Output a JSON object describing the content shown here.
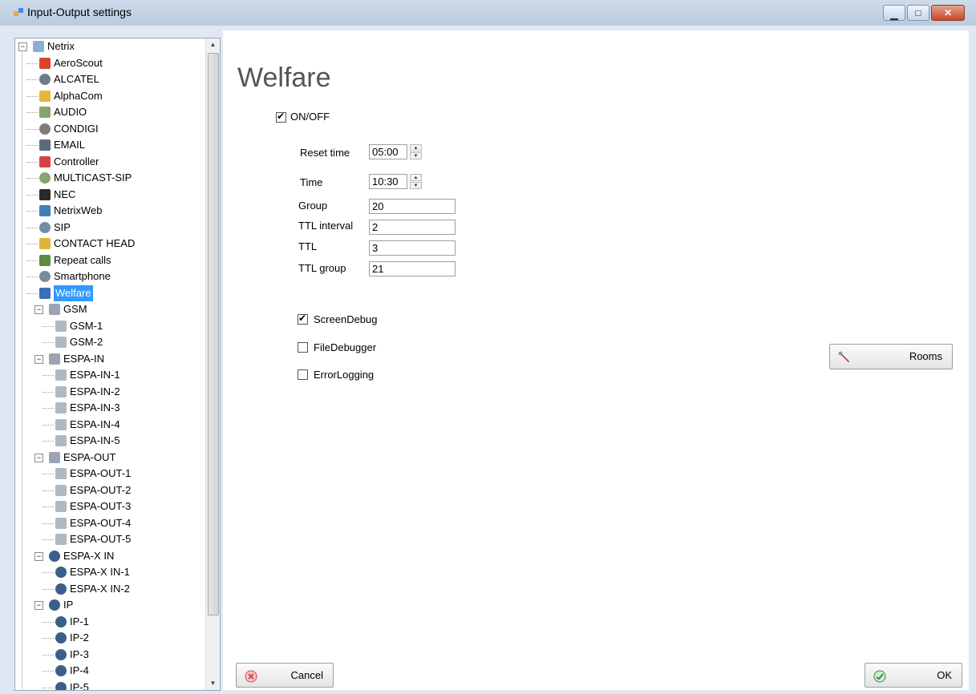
{
  "window": {
    "title": "Input-Output settings"
  },
  "tree": {
    "root": "Netrix",
    "items": [
      "AeroScout",
      "ALCATEL",
      "AlphaCom",
      "AUDIO",
      "CONDIGI",
      "EMAIL",
      "Controller",
      "MULTICAST-SIP",
      "NEC",
      "NetrixWeb",
      "SIP",
      "CONTACT HEAD",
      "Repeat calls",
      "Smartphone",
      "Welfare"
    ],
    "groups": [
      {
        "label": "GSM",
        "children": [
          "GSM-1",
          "GSM-2"
        ]
      },
      {
        "label": "ESPA-IN",
        "children": [
          "ESPA-IN-1",
          "ESPA-IN-2",
          "ESPA-IN-3",
          "ESPA-IN-4",
          "ESPA-IN-5"
        ]
      },
      {
        "label": "ESPA-OUT",
        "children": [
          "ESPA-OUT-1",
          "ESPA-OUT-2",
          "ESPA-OUT-3",
          "ESPA-OUT-4",
          "ESPA-OUT-5"
        ]
      },
      {
        "label": "ESPA-X IN",
        "children": [
          "ESPA-X IN-1",
          "ESPA-X IN-2"
        ]
      },
      {
        "label": "IP",
        "children": [
          "IP-1",
          "IP-2",
          "IP-3",
          "IP-4",
          "IP-5"
        ]
      }
    ],
    "selected": "Welfare"
  },
  "main": {
    "title": "Welfare",
    "onoff": {
      "label": "ON/OFF",
      "checked": true
    },
    "fields": {
      "reset_time": {
        "label": "Reset time",
        "value": "05:00"
      },
      "time": {
        "label": "Time",
        "value": "10:30"
      },
      "group": {
        "label": "Group",
        "value": "20"
      },
      "ttl_interval": {
        "label": "TTL interval",
        "value": "2"
      },
      "ttl": {
        "label": "TTL",
        "value": "3"
      },
      "ttl_group": {
        "label": "TTL group",
        "value": "21"
      }
    },
    "options": {
      "screen_debug": {
        "label": "ScreenDebug",
        "checked": true
      },
      "file_debugger": {
        "label": "FileDebugger",
        "checked": false
      },
      "error_logging": {
        "label": "ErrorLogging",
        "checked": false
      }
    },
    "buttons": {
      "rooms": "Rooms",
      "cancel": "Cancel",
      "ok": "OK"
    }
  }
}
